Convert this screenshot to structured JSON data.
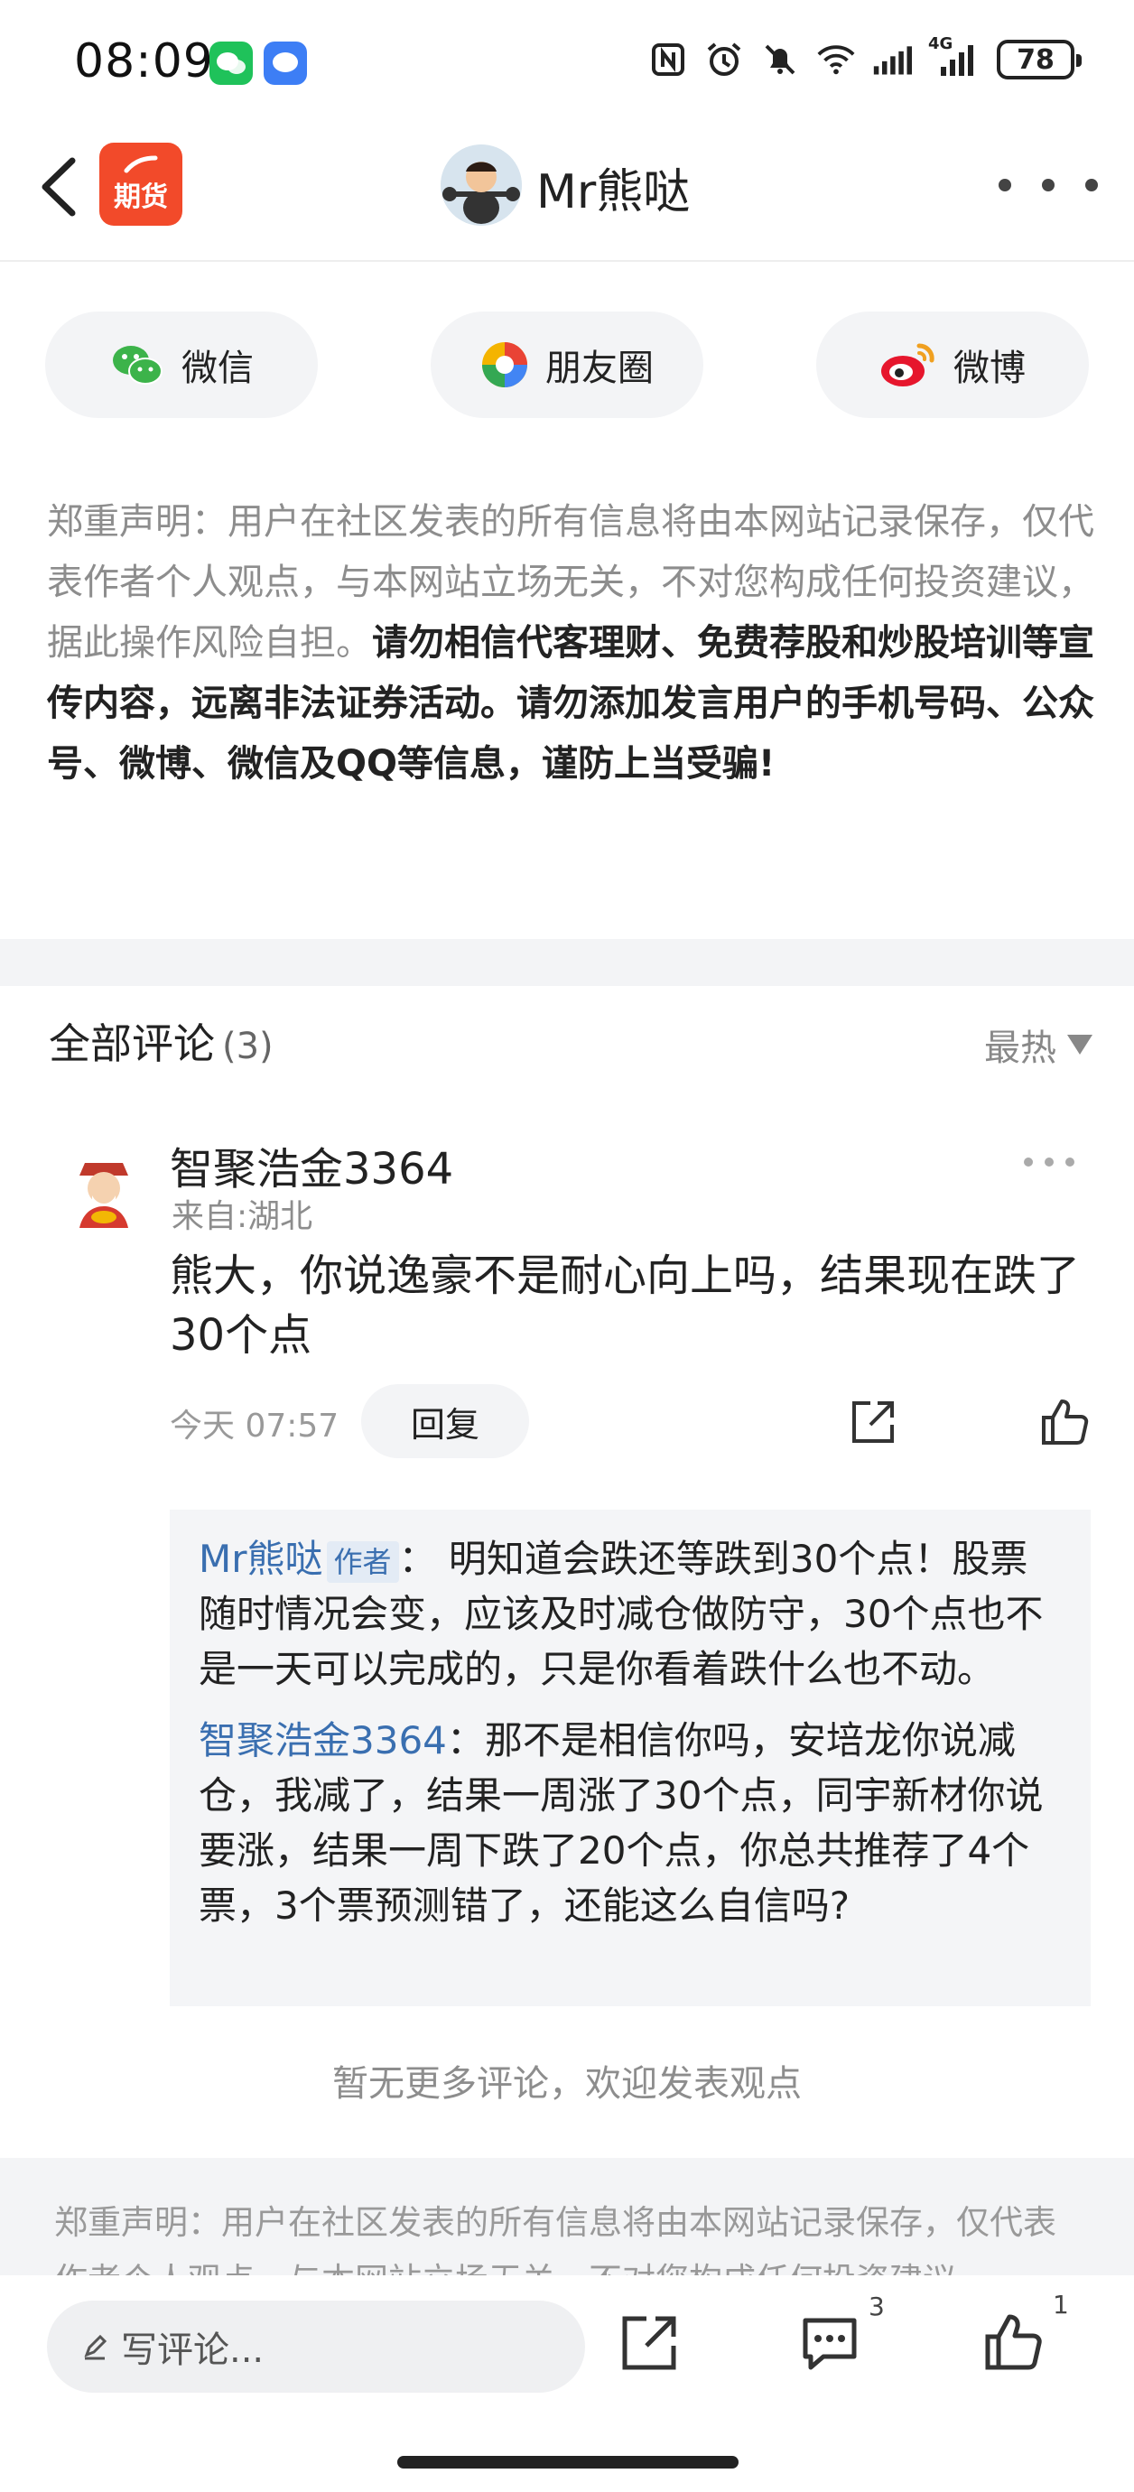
{
  "status": {
    "time": "08:09",
    "battery": "78",
    "network_label": "4G"
  },
  "header": {
    "app_name": "期货",
    "title": "Mr熊哒"
  },
  "share": {
    "wechat": "微信",
    "moments": "朋友圈",
    "weibo": "微博"
  },
  "disclaimer": {
    "label": "郑重声明：",
    "normal": "用户在社区发表的所有信息将由本网站记录保存，仅代表作者个人观点，与本网站立场无关，不对您构成任何投资建议，据此操作风险自担。",
    "bold": "请勿相信代客理财、免费荐股和炒股培训等宣传内容，远离非法证券活动。请勿添加发言用户的手机号码、公众号、微博、微信及QQ等信息，谨防上当受骗!"
  },
  "comments": {
    "title": "全部评论",
    "count": "(3)",
    "sort": "最热",
    "items": [
      {
        "user": "智聚浩金3364",
        "location": "来自:湖北",
        "text": "熊大，你说逸豪不是耐心向上吗，结果现在跌了30个点",
        "time": "今天 07:57",
        "reply_label": "回复",
        "replies": [
          {
            "user": "Mr熊哒",
            "tag": "作者",
            "text": "： 明知道会跌还等跌到30个点！股票随时情况会变，应该及时减仓做防守，30个点也不是一天可以完成的，只是你看着跌什么也不动。"
          },
          {
            "user": "智聚浩金3364",
            "text": "：那不是相信你吗，安培龙你说减仓，我减了，结果一周涨了30个点，同宇新材你说要涨，结果一周下跌了20个点，你总共推荐了4个票，3个票预测错了，还能这么自信吗?"
          }
        ]
      }
    ],
    "no_more": "暂无更多评论，欢迎发表观点"
  },
  "footer_disclaimer": "郑重声明：用户在社区发表的所有信息将由本网站记录保存，仅代表作者个人观点，与本网站立场无关，不对您构成任何投资建议",
  "bottom": {
    "placeholder": "写评论...",
    "comment_count": "3",
    "like_count": "1"
  },
  "colors": {
    "accent_blue": "#3a6fb0",
    "app_red": "#f24a2a"
  }
}
